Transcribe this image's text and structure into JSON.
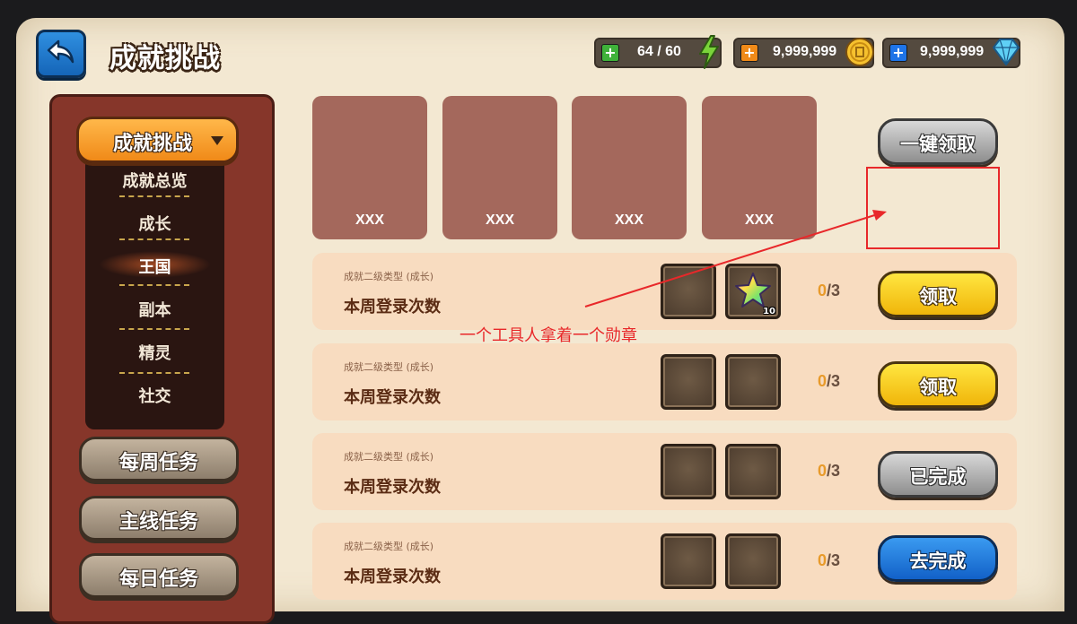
{
  "header": {
    "title": "成就挑战"
  },
  "resources": {
    "energy": {
      "value": "64 / 60",
      "icon": "lightning-icon",
      "color": "#3fb23a"
    },
    "gold": {
      "value": "9,999,999",
      "icon": "gold-coin-icon",
      "color": "#f08a18"
    },
    "diamond": {
      "value": "9,999,999",
      "icon": "diamond-icon",
      "color": "#1e74e8"
    }
  },
  "sidebar": {
    "category": "成就挑战",
    "sub_items": [
      {
        "label": "成就总览"
      },
      {
        "label": "成长"
      },
      {
        "label": "王国"
      },
      {
        "label": "副本"
      },
      {
        "label": "精灵"
      },
      {
        "label": "社交"
      }
    ],
    "active_index": 2,
    "buttons": [
      {
        "label": "每周任务"
      },
      {
        "label": "主线任务"
      },
      {
        "label": "每日任务"
      }
    ]
  },
  "cards": [
    {
      "label": "XXX"
    },
    {
      "label": "XXX"
    },
    {
      "label": "XXX"
    },
    {
      "label": "XXX"
    }
  ],
  "claim_all_label": "一键领取",
  "rows": [
    {
      "type": "成就二级类型 (成长)",
      "name": "本周登录次数",
      "progress_current": "0",
      "progress_total": "/3",
      "button": "领取",
      "state": "yellow",
      "reward_qty": "10"
    },
    {
      "type": "成就二级类型 (成长)",
      "name": "本周登录次数",
      "progress_current": "0",
      "progress_total": "/3",
      "button": "领取",
      "state": "yellow"
    },
    {
      "type": "成就二级类型 (成长)",
      "name": "本周登录次数",
      "progress_current": "0",
      "progress_total": "/3",
      "button": "已完成",
      "state": "gray"
    },
    {
      "type": "成就二级类型 (成长)",
      "name": "本周登录次数",
      "progress_current": "0",
      "progress_total": "/3",
      "button": "去完成",
      "state": "blue"
    }
  ],
  "annotation": {
    "text": "一个工具人拿着一个勋章",
    "color": "#e8282a"
  }
}
